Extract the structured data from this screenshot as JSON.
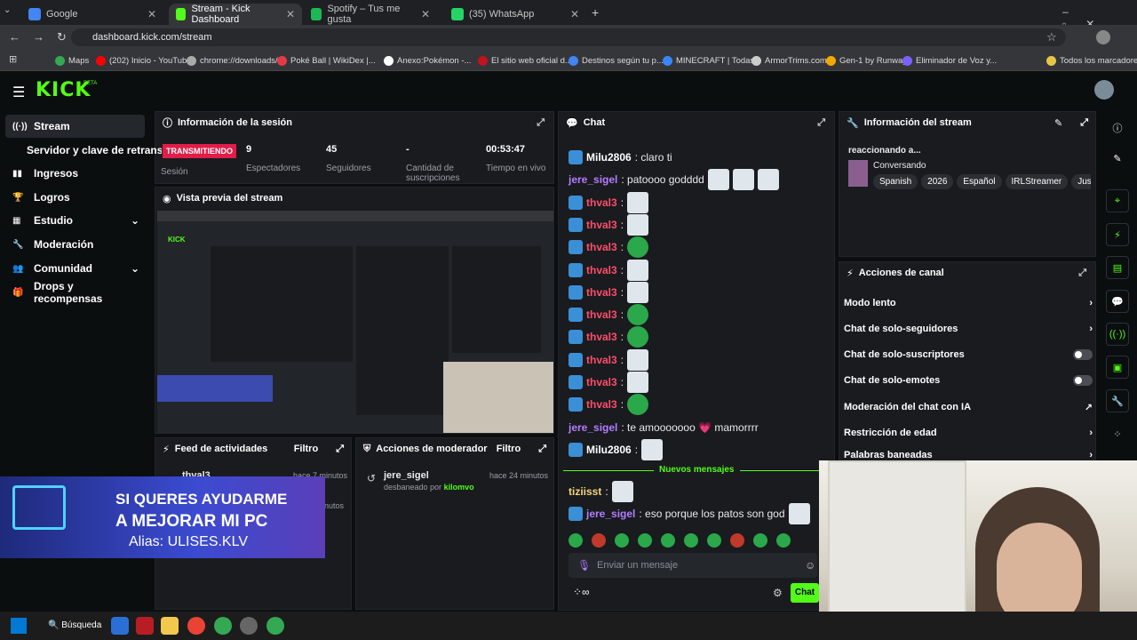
{
  "browser": {
    "tabs": [
      {
        "title": "Google",
        "color": "#4285f4"
      },
      {
        "title": "Stream - Kick Dashboard",
        "color": "#53fc18"
      },
      {
        "title": "Spotify – Tus me gusta",
        "color": "#1db954"
      },
      {
        "title": "(35) WhatsApp",
        "color": "#25d366"
      }
    ],
    "url": "dashboard.kick.com/stream",
    "bookmarks": [
      "Maps",
      "(202) Inicio - YouTube",
      "chrome://downloads/",
      "Poké Ball | WikiDex |...",
      "Anexo:Pokémon -...",
      "El sitio web oficial d...",
      "Destinos según tu p...",
      "MINECRAFT | Todas...",
      "ArmorTrims.com",
      "Gen-1 by Runway",
      "Eliminador de Voz y...",
      "Todos los marcadores"
    ]
  },
  "app": {
    "logo": "KICK",
    "logo_badge": "BETA",
    "sidebar": [
      {
        "label": "Stream",
        "icon": "broadcast-icon"
      },
      {
        "label": "Servidor y clave de retransmisión",
        "icon": ""
      },
      {
        "label": "Ingresos",
        "icon": "chart-icon"
      },
      {
        "label": "Logros",
        "icon": "trophy-icon"
      },
      {
        "label": "Estudio",
        "icon": "studio-icon"
      },
      {
        "label": "Moderación",
        "icon": "wrench-icon"
      },
      {
        "label": "Comunidad",
        "icon": "people-icon"
      },
      {
        "label": "Drops y recompensas",
        "icon": "gift-icon"
      }
    ]
  },
  "session": {
    "title": "Información de la sesión",
    "status": "TRANSMITIENDO",
    "status_label": "Sesión",
    "viewers": "9",
    "viewers_label": "Espectadores",
    "followers": "45",
    "followers_label": "Seguidores",
    "subs": "-",
    "subs_label": "Cantidad de suscripciones",
    "time": "00:53:47",
    "time_label": "Tiempo en vivo"
  },
  "preview": {
    "title": "Vista previa del stream"
  },
  "activity": {
    "title": "Feed de actividades",
    "filter": "Filtro",
    "user": "thval3",
    "time": "hace 7 minutos",
    "time2": "nutos"
  },
  "modactions": {
    "title": "Acciones de moderador",
    "filter": "Filtro",
    "user": "jere_sigel",
    "time": "hace 24 minutos",
    "action": "desbaneado por",
    "by": "kilomvo"
  },
  "overlay": {
    "line1": "SI QUERES AYUDARME",
    "line2": "A MEJORAR MI PC",
    "line3": "Alias: ULISES.KLV"
  },
  "chat": {
    "title": "Chat",
    "messages": [
      {
        "user": "Milu2806",
        "text": ": claro ti",
        "color": "#ffffff",
        "badge": true,
        "emotes": 0
      },
      {
        "user": "jere_sigel",
        "text": ": patoooo godddd",
        "color": "#b57cff",
        "badge": false,
        "emotes": 3
      },
      {
        "user": "thval3",
        "text": ":",
        "color": "#ff4d6a",
        "badge": true,
        "emotes": 1
      },
      {
        "user": "thval3",
        "text": ":",
        "color": "#ff4d6a",
        "badge": true,
        "emotes": 1
      },
      {
        "user": "thval3",
        "text": ":",
        "color": "#ff4d6a",
        "badge": true,
        "emotes": 1
      },
      {
        "user": "thval3",
        "text": ":",
        "color": "#ff4d6a",
        "badge": true,
        "emotes": 1
      },
      {
        "user": "thval3",
        "text": ":",
        "color": "#ff4d6a",
        "badge": true,
        "emotes": 1
      },
      {
        "user": "thval3",
        "text": ":",
        "color": "#ff4d6a",
        "badge": true,
        "emotes": 1
      },
      {
        "user": "thval3",
        "text": ":",
        "color": "#ff4d6a",
        "badge": true,
        "emotes": 1
      },
      {
        "user": "thval3",
        "text": ":",
        "color": "#ff4d6a",
        "badge": true,
        "emotes": 1
      },
      {
        "user": "thval3",
        "text": ":",
        "color": "#ff4d6a",
        "badge": true,
        "emotes": 1
      },
      {
        "user": "thval3",
        "text": ":",
        "color": "#ff4d6a",
        "badge": true,
        "emotes": 1
      },
      {
        "user": "jere_sigel",
        "text": ": te amooooooo 💗 mamorrrr",
        "color": "#b57cff",
        "badge": false,
        "emotes": 0
      },
      {
        "user": "Milu2806",
        "text": ":",
        "color": "#ffffff",
        "badge": true,
        "emotes": 1
      }
    ],
    "new_messages": "Nuevos mensajes",
    "after": [
      {
        "user": "tiziisst",
        "text": ":",
        "color": "#f5d37a",
        "badge": false,
        "emotes": 1
      },
      {
        "user": "jere_sigel",
        "text": ": eso porque los patos son god",
        "color": "#b57cff",
        "badge": true,
        "emotes": 1
      }
    ],
    "placeholder": "Enviar un mensaje",
    "send": "Chat"
  },
  "streaminfo": {
    "title": "Información del stream",
    "reacting": "reaccionando a...",
    "category": "Conversando",
    "tags": [
      "Spanish",
      "2026",
      "Español",
      "IRLStreamer",
      "JustC"
    ]
  },
  "channel_actions": {
    "title": "Acciones de canal",
    "items": [
      {
        "label": "Modo lento",
        "control": "chevron"
      },
      {
        "label": "Chat de solo-seguidores",
        "control": "chevron"
      },
      {
        "label": "Chat de solo-suscriptores",
        "control": "toggle"
      },
      {
        "label": "Chat de solo-emotes",
        "control": "toggle"
      },
      {
        "label": "Moderación del chat con IA",
        "control": "external"
      },
      {
        "label": "Restricción de edad",
        "control": "chevron"
      },
      {
        "label": "Palabras baneadas",
        "control": "chevron"
      }
    ]
  },
  "taskbar": {
    "search": "Búsqueda"
  }
}
